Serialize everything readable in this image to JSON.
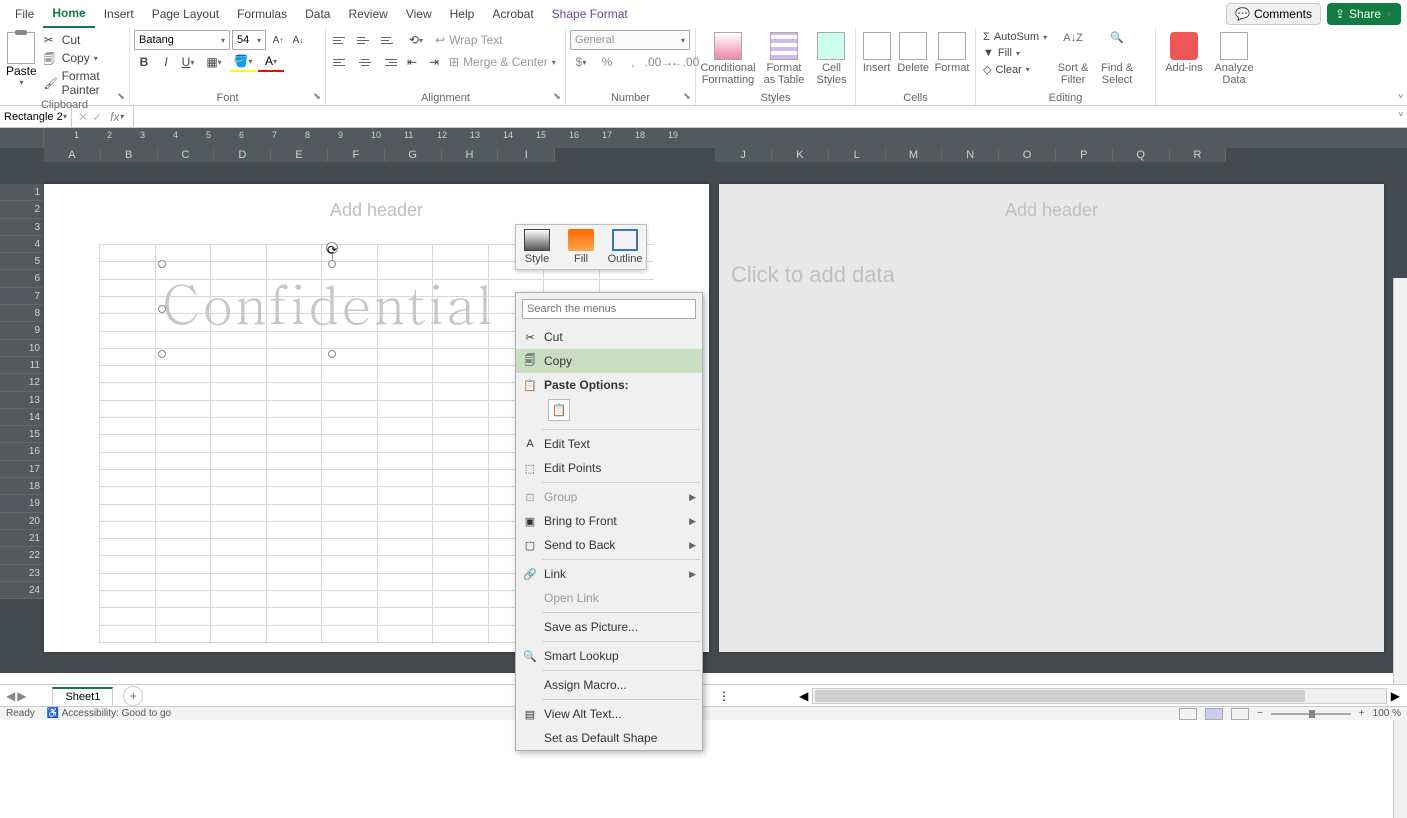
{
  "tabs": {
    "file": "File",
    "home": "Home",
    "insert": "Insert",
    "pageLayout": "Page Layout",
    "formulas": "Formulas",
    "data": "Data",
    "review": "Review",
    "view": "View",
    "help": "Help",
    "acrobat": "Acrobat",
    "shapeFormat": "Shape Format"
  },
  "topRight": {
    "comments": "Comments",
    "share": "Share"
  },
  "ribbon": {
    "clipboard": {
      "paste": "Paste",
      "cut": "Cut",
      "copy": "Copy",
      "formatPainter": "Format Painter",
      "label": "Clipboard"
    },
    "font": {
      "name": "Batang",
      "size": "54",
      "label": "Font"
    },
    "alignment": {
      "wrapText": "Wrap Text",
      "mergeCenter": "Merge & Center",
      "label": "Alignment"
    },
    "number": {
      "format": "General",
      "label": "Number"
    },
    "styles": {
      "cond": "Conditional Formatting",
      "table": "Format as Table",
      "cell": "Cell Styles",
      "label": "Styles"
    },
    "cells": {
      "insert": "Insert",
      "delete": "Delete",
      "format": "Format",
      "label": "Cells"
    },
    "editing": {
      "autosum": "AutoSum",
      "fill": "Fill",
      "clear": "Clear",
      "sort": "Sort & Filter",
      "find": "Find & Select",
      "label": "Editing"
    },
    "addins": {
      "addins": "Add-ins",
      "analyze": "Analyze Data"
    }
  },
  "nameBox": "Rectangle 2",
  "worksheet": {
    "columns": [
      "A",
      "B",
      "C",
      "D",
      "E",
      "F",
      "G",
      "H",
      "I",
      "J",
      "K",
      "L",
      "M",
      "N",
      "O",
      "P",
      "Q",
      "R"
    ],
    "headerPlaceholder": "Add header",
    "clickToAdd": "Click to add data",
    "shapeText": "Confidential",
    "rulerTicks": [
      "1",
      "2",
      "3",
      "4",
      "5",
      "6",
      "7",
      "8",
      "9",
      "10",
      "11",
      "12",
      "13",
      "14",
      "15",
      "16",
      "17",
      "18",
      "19"
    ]
  },
  "miniToolbar": {
    "style": "Style",
    "fill": "Fill",
    "outline": "Outline"
  },
  "contextMenu": {
    "searchPlaceholder": "Search the menus",
    "cut": "Cut",
    "copy": "Copy",
    "pasteOptions": "Paste Options:",
    "editText": "Edit Text",
    "editPoints": "Edit Points",
    "group": "Group",
    "bringToFront": "Bring to Front",
    "sendToBack": "Send to Back",
    "link": "Link",
    "openLink": "Open Link",
    "saveAsPicture": "Save as Picture...",
    "smartLookup": "Smart Lookup",
    "assignMacro": "Assign Macro...",
    "viewAltText": "View Alt Text...",
    "setDefault": "Set as Default Shape"
  },
  "sheetTabs": {
    "sheet1": "Sheet1"
  },
  "statusBar": {
    "ready": "Ready",
    "accessibility": "Accessibility: Good to go",
    "zoom": "100 %"
  }
}
